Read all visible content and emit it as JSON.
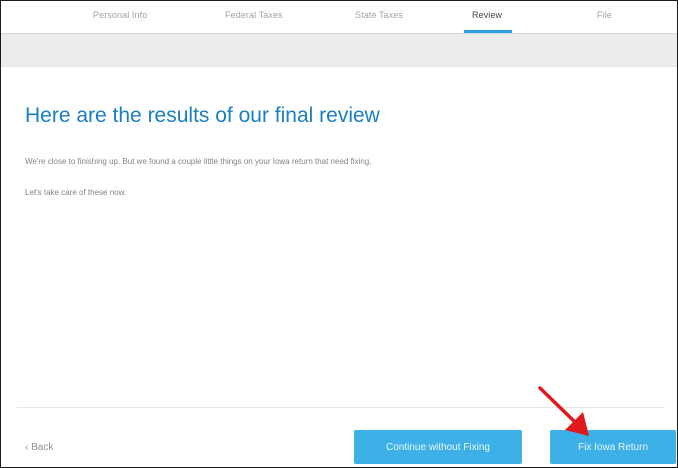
{
  "steps": {
    "items": [
      {
        "label": "Personal Info"
      },
      {
        "label": "Federal Taxes"
      },
      {
        "label": "State Taxes"
      },
      {
        "label": "Review"
      },
      {
        "label": "File"
      }
    ],
    "active": "Review"
  },
  "main": {
    "title": "Here are the results of our final review",
    "paragraph_1": "We're close to finishing up. But we found a couple little things on your Iowa return that need fixing.",
    "paragraph_2": "Let's take care of these now."
  },
  "footer": {
    "back_label": "‹ Back",
    "continue_label": "Continue without Fixing",
    "fix_label": "Fix Iowa Return"
  },
  "colors": {
    "accent": "#2ca3e2",
    "title": "#1a7fc1",
    "button": "#3db0e8",
    "annotation_arrow": "#e0191f"
  },
  "annotation": {
    "icon": "red-arrow-icon"
  }
}
